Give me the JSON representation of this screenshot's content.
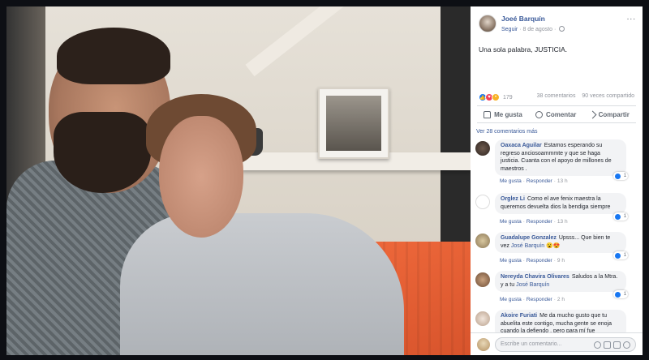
{
  "post": {
    "author": "Joeé Barquín",
    "follow_label": "Seguir",
    "date": "8 de agosto",
    "text": "Una sola palabra, JUSTICIA.",
    "reactions_count": "179",
    "comments_count": "38 comentarios",
    "shares_count": "90 veces compartido",
    "more_icon": "..."
  },
  "actions": {
    "like": "Me gusta",
    "comment": "Comentar",
    "share": "Compartir"
  },
  "comments": {
    "more_label": "Ver 28 comentarios más",
    "items": [
      {
        "name": "Oaxaca Aguilar",
        "text": "Estamos esperando su regreso anciosoammmte y que se haga justicia. Cuanta con el apoyo de millones de maestros .",
        "like": "Me gusta",
        "reply": "Responder",
        "time": "13 h",
        "reactions": "1"
      },
      {
        "name": "Orglez Li",
        "text": "Como el ave fenix maestra la queremos devuelta dios la bendiga siempre",
        "like": "Me gusta",
        "reply": "Responder",
        "time": "13 h",
        "reactions": "1"
      },
      {
        "name": "Guadalupe Gonzalez",
        "text": "Upsss... Que bien te vez",
        "mention": "José Barquín",
        "emoji": "😮😍",
        "like": "Me gusta",
        "reply": "Responder",
        "time": "9 h",
        "reactions": "1"
      },
      {
        "name": "Nereyda Chavira Olivares",
        "text": "Saludos a la Mtra. y a tu",
        "mention": "José Barquín",
        "like": "Me gusta",
        "reply": "Responder",
        "time": "2 h",
        "reactions": "1"
      },
      {
        "name": "Akoire Furiati",
        "text": "Me da mucho gusto que tu abuelita este contigo, mucha gente se enoja cuando la defiendo , pero para mí fue"
      }
    ]
  },
  "composer": {
    "placeholder": "Escribe un comentario..."
  },
  "colors": {
    "link": "#385898",
    "muted": "#90949c",
    "bubble": "#f2f3f5",
    "like_blue": "#1877f2",
    "sofa": "#e8603a"
  }
}
